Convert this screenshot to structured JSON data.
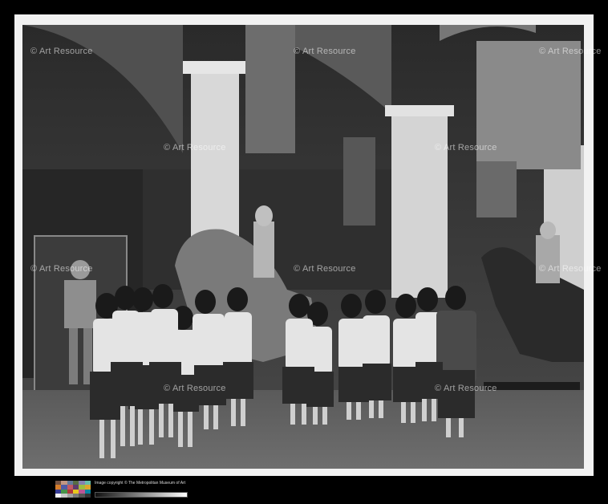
{
  "watermark": {
    "text": "© Art Resource"
  },
  "caption": {
    "copyright": "Image copyright © The Metropolitan Museum of Art"
  },
  "colors": {
    "border": "#f2f2f2",
    "background": "#000000"
  }
}
